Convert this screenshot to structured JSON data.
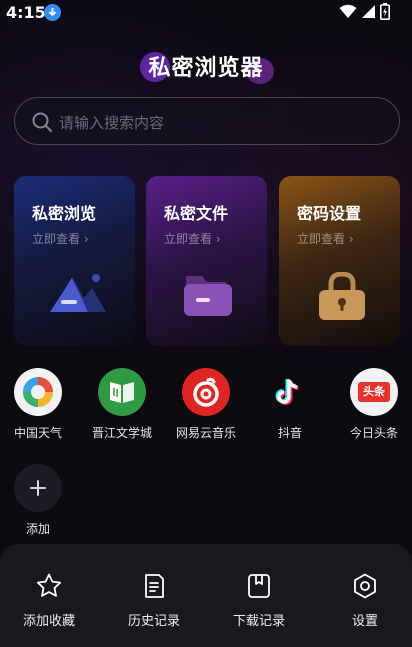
{
  "status_bar": {
    "time": "4:15"
  },
  "app": {
    "title": "私密浏览器"
  },
  "search": {
    "placeholder": "请输入搜索内容"
  },
  "cards": [
    {
      "title": "私密浏览",
      "subtitle": "立即查看 ›",
      "icon": "mountain-image-icon",
      "accent": "#1d2c7a"
    },
    {
      "title": "私密文件",
      "subtitle": "立即查看 ›",
      "icon": "folder-icon",
      "accent": "#5a1f8a"
    },
    {
      "title": "密码设置",
      "subtitle": "立即查看 ›",
      "icon": "lock-icon",
      "accent": "#8a5415"
    }
  ],
  "shortcuts": [
    {
      "label": "中国天气",
      "icon": "china-weather-icon"
    },
    {
      "label": "晋江文学城",
      "icon": "jinjiang-book-icon"
    },
    {
      "label": "网易云音乐",
      "icon": "netease-music-icon"
    },
    {
      "label": "抖音",
      "icon": "douyin-icon"
    },
    {
      "label": "今日头条",
      "icon": "toutiao-icon",
      "icon_text": "头条"
    }
  ],
  "add": {
    "label": "添加"
  },
  "bottom_nav": [
    {
      "label": "添加收藏",
      "icon": "star-icon"
    },
    {
      "label": "历史记录",
      "icon": "history-document-icon"
    },
    {
      "label": "下载记录",
      "icon": "download-record-icon"
    },
    {
      "label": "设置",
      "icon": "gear-icon"
    }
  ]
}
